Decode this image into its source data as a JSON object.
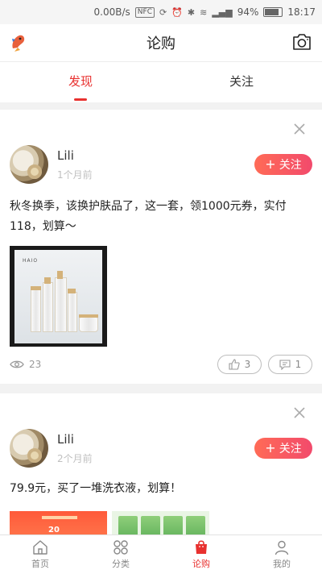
{
  "status_bar": {
    "speed": "0.00B/s",
    "nfc": "NFC",
    "battery": "94%",
    "time": "18:17"
  },
  "header": {
    "title": "论购"
  },
  "tabs": [
    {
      "label": "发现",
      "active": true
    },
    {
      "label": "关注",
      "active": false
    }
  ],
  "posts": [
    {
      "username": "Lili",
      "time": "1个月前",
      "follow_label": "关注",
      "content": "秋冬换季，该换护肤品了，这一套，领1000元券，实付118，划算～",
      "product_brand": "HAIO",
      "views": "23",
      "likes": "3",
      "comments": "1"
    },
    {
      "username": "Lili",
      "time": "2个月前",
      "follow_label": "关注",
      "content": "79.9元，买了一堆洗衣液，划算！",
      "thumb_number": "20"
    }
  ],
  "bottom_nav": [
    {
      "label": "首页",
      "icon": "home-icon",
      "active": false
    },
    {
      "label": "分类",
      "icon": "grid-icon",
      "active": false
    },
    {
      "label": "论购",
      "icon": "shopping-bag-icon",
      "active": true
    },
    {
      "label": "我的",
      "icon": "user-icon",
      "active": false
    }
  ],
  "colors": {
    "accent": "#e8312f",
    "follow_gradient_start": "#ff6b56",
    "follow_gradient_end": "#f24a6c"
  }
}
